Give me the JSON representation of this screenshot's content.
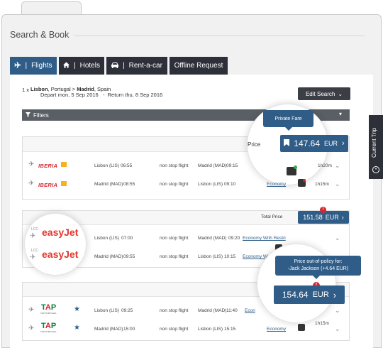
{
  "page_title": "Search & Book",
  "tabs": [
    {
      "label": "Flights",
      "icon": "plane-icon"
    },
    {
      "label": "Hotels",
      "icon": "home-icon"
    },
    {
      "label": "Rent-a-car",
      "icon": "car-icon"
    },
    {
      "label": "Offline Request",
      "icon": ""
    }
  ],
  "tab_separator": "|",
  "search": {
    "passengers": "1 x",
    "origin_city": "Lisbon",
    "origin_country": ", Portugal > ",
    "dest_city": "Madrid",
    "dest_country": ", Spain",
    "dates": "Depart mon, 5 Sep 2016   -  Return thu, 8 Sep 2016",
    "edit_label": "Edit Search"
  },
  "filters_label": "Filters",
  "current_trip_label": "Current Trip",
  "cards": [
    {
      "price_label": "Price",
      "price": "147.64",
      "currency": "EUR",
      "tooltip": "Private Fare",
      "rows": [
        {
          "airline": "IBERIA",
          "from": "Lisbon (LIS)",
          "dep": "06:55",
          "stops": "non stop flight",
          "to": "Madrid (MAD)",
          "arr": "09:15",
          "cabin": "",
          "duration": "1h20m"
        },
        {
          "airline": "IBERIA",
          "from": "Madrid (MAD)",
          "dep": "08:55",
          "stops": "non stop flight",
          "to": "Lisbon (LIS)",
          "arr": "09:10",
          "cabin": "Economy",
          "duration": "1h15m"
        }
      ]
    },
    {
      "price_label": "Total Price",
      "price": "151.58",
      "currency": "EUR",
      "rows": [
        {
          "airline": "easyJet",
          "tag": "LCC",
          "from": "Lisbon (LIS)",
          "dep": "07:00",
          "stops": "non stop flight",
          "to": "Madrid (MAD)",
          "arr": "09:20",
          "cabin": "Economy With Restri",
          "duration": ""
        },
        {
          "airline": "easyJet",
          "tag": "LCC",
          "from": "Madrid (MAD)",
          "dep": "09:55",
          "stops": "non stop flight",
          "to": "Lisbon (LIS)",
          "arr": "10:15",
          "cabin": "Economy With Re",
          "duration": "1h20m"
        }
      ]
    },
    {
      "price": "154.64",
      "currency": "EUR",
      "tooltip_line1": "Price out-of-policy for:",
      "tooltip_line2": "-Jack Jackson (+4.64 EUR)",
      "rows": [
        {
          "airline": "TAP",
          "airline_sub": "TAP PORTUGAL",
          "from": "Lisbon (LIS)",
          "dep": "09:25",
          "stops": "non stop flight",
          "to": "Madrid (MAD)",
          "arr": "11:40",
          "cabin": "Econ",
          "duration": ""
        },
        {
          "airline": "TAP",
          "airline_sub": "TAP PORTUGAL",
          "from": "Madrid (MAD)",
          "dep": "15:00",
          "stops": "non stop flight",
          "to": "Lisbon (LIS)",
          "arr": "15:15",
          "cabin": "Economy",
          "duration": "1h15m"
        }
      ]
    }
  ],
  "colors": {
    "accent": "#2f5d88",
    "dark": "#2d3038",
    "iberia": "#d22630",
    "easyjet": "#e4362d",
    "tap_green": "#00843d"
  }
}
